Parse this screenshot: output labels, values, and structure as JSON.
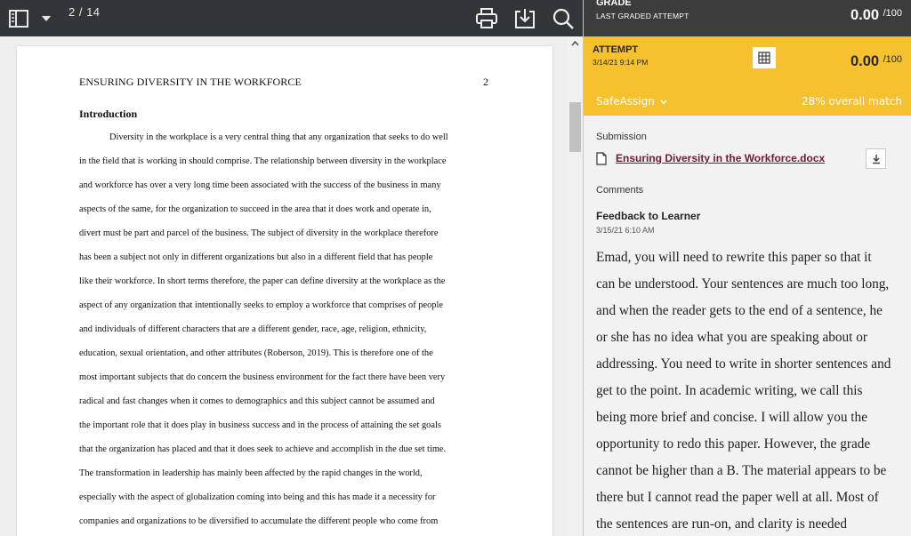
{
  "viewer": {
    "toolbar": {
      "page_indicator": "2 / 14"
    },
    "page": {
      "running_head": "ENSURING DIVERSITY IN THE WORKFORCE",
      "page_number": "2",
      "section_heading": "Introduction",
      "lines": [
        "Diversity in the workplace is a very central thing that any organization that seeks to do well",
        "in the field that is working in should comprise. The relationship between diversity in the workplace",
        "and workforce has over a very long time been associated with the success of the business in many",
        "aspects of the same, for the organization to succeed in the area that it does work and operate in,",
        "divert must be part and parcel of the business. The subject of diversity in the workplace therefore",
        "has been a subject not only in different organizations but also in a different field that has people",
        "like their workforce. In short terms therefore, the paper can define diversity at the workplace as the",
        "aspect of any organization that intentionally seeks to employ a workforce that comprises of people",
        "and individuals of different characters that are a different gender, race, age, religion, ethnicity,",
        "education, sexual orientation, and other attributes (Roberson, 2019). This is therefore one of the",
        "most important subjects that do concern the business environment for the fact there have been very",
        "radical and fast changes when it comes to demographics and this subject cannot be assumed and",
        "the important role that it does play in business success and in the process of attaining the set goals",
        "that the organization has placed and that it does seek to achieve and accomplish in the due set time.",
        "The transformation in leadership has mainly been affected by the rapid changes in the world,",
        "especially with the aspect of globalization coming into being and this has made it a necessity for",
        "companies and organizations to be diversified to accumulate the different people who come from"
      ]
    }
  },
  "panel": {
    "grade": {
      "title": "GRADE",
      "subtitle": "LAST GRADED ATTEMPT",
      "score": "0.00",
      "max": "/100"
    },
    "attempt": {
      "title": "ATTEMPT",
      "date": "3/14/21 9:14 PM",
      "score": "0.00",
      "max": "/100",
      "safeassign_label": "SafeAssign",
      "match_text": "28% overall match",
      "color": "#f6c12f"
    },
    "submission": {
      "label": "Submission",
      "file_name": "Ensuring Diversity in the Workforce.docx"
    },
    "comments": {
      "label": "Comments",
      "feedback_title": "Feedback to Learner",
      "feedback_date": "3/15/21 6:10 AM",
      "feedback_lines": [
        "Emad, you will need to rewrite this paper so that it",
        "can be understood. Your sentences are much too long,",
        "and when the reader gets to the end of a sentence, he",
        "or she has no idea what you are speaking about or",
        "addressing. You need to write in shorter sentences and",
        "get to the point. In academic writing, we call this",
        "being more brief and concise. I will allow you the",
        "opportunity to redo this paper. However, the grade",
        "cannot be higher than a B. The material appears to be",
        "there but I cannot read the paper well at all. Most of",
        "the sentences are run-on, and clarity is needed"
      ]
    }
  },
  "icons": [
    "sidebar-toggle-icon",
    "dropdown-arrow-icon",
    "print-icon",
    "download-icon",
    "search-icon",
    "scroll-up-icon",
    "grid-icon",
    "chevron-down-icon",
    "document-icon",
    "download-icon"
  ]
}
